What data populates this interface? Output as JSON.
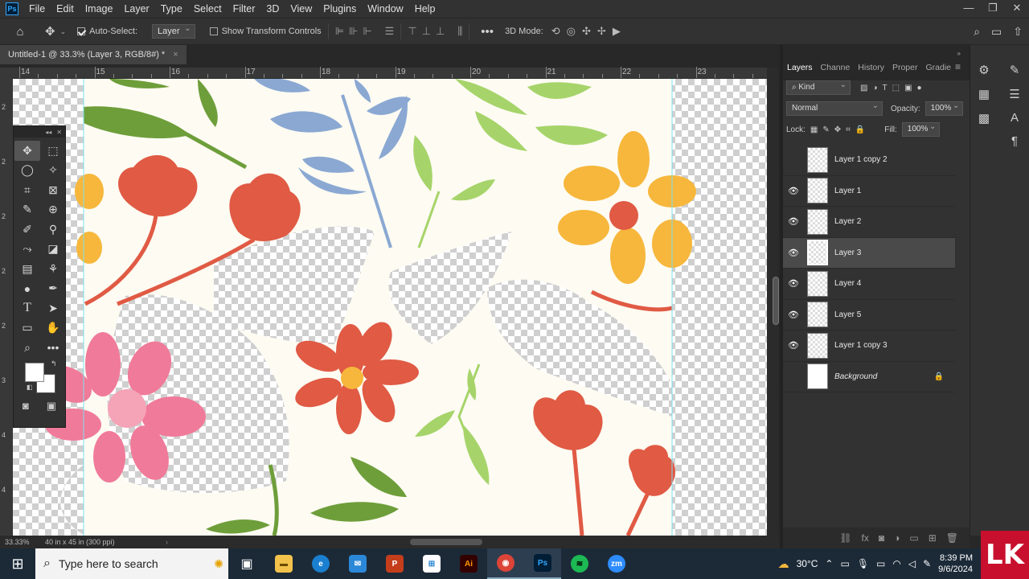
{
  "menu": {
    "app_logo": "Ps",
    "items": [
      "File",
      "Edit",
      "Image",
      "Layer",
      "Type",
      "Select",
      "Filter",
      "3D",
      "View",
      "Plugins",
      "Window",
      "Help"
    ],
    "window_controls": [
      "—",
      "❐",
      "✕"
    ]
  },
  "options": {
    "auto_select_label": "Auto-Select:",
    "auto_select_checked": true,
    "auto_select_target": "Layer",
    "show_transform_label": "Show Transform Controls",
    "show_transform_checked": false,
    "mode_3d_label": "3D Mode:"
  },
  "document": {
    "tab_title": "Untitled-1 @ 33.3% (Layer 3, RGB/8#) *",
    "close_glyph": "×"
  },
  "ruler": {
    "h_labels": [
      "14",
      "15",
      "16",
      "17",
      "18",
      "19",
      "20",
      "21",
      "22",
      "23"
    ],
    "v_labels": [
      "2",
      "2",
      "2",
      "2",
      "2",
      "3",
      "4",
      "4"
    ]
  },
  "status": {
    "zoom": "33.33%",
    "doc_size": "40 in x 45 in (300 ppi)",
    "arrow": "›"
  },
  "layers_panel": {
    "tabs": [
      "Layers",
      "Channe",
      "History",
      "Proper",
      "Gradie"
    ],
    "active_tab": "Layers",
    "filter_kind": "Kind",
    "blend_mode": "Normal",
    "opacity_label": "Opacity:",
    "opacity": "100%",
    "lock_label": "Lock:",
    "fill_label": "Fill:",
    "fill": "100%",
    "layers": [
      {
        "name": "Layer 1 copy 2",
        "visible": false,
        "selected": false,
        "italic": false,
        "locked": false
      },
      {
        "name": "Layer 1",
        "visible": true,
        "selected": false,
        "italic": false,
        "locked": false
      },
      {
        "name": "Layer 2",
        "visible": true,
        "selected": false,
        "italic": false,
        "locked": false
      },
      {
        "name": "Layer 3",
        "visible": true,
        "selected": true,
        "italic": false,
        "locked": false
      },
      {
        "name": "Layer 4",
        "visible": true,
        "selected": false,
        "italic": false,
        "locked": false
      },
      {
        "name": "Layer 5",
        "visible": true,
        "selected": false,
        "italic": false,
        "locked": false
      },
      {
        "name": "Layer 1 copy 3",
        "visible": true,
        "selected": false,
        "italic": false,
        "locked": false
      },
      {
        "name": "Background",
        "visible": false,
        "selected": false,
        "italic": true,
        "locked": true
      }
    ]
  },
  "taskbar": {
    "search_placeholder": "Type here to search",
    "temperature": "30°C",
    "time": "8:39 PM",
    "date": "9/6/2024",
    "apps": [
      "task-view",
      "file-explorer",
      "edge",
      "mail",
      "powerpoint",
      "store",
      "illustrator",
      "chrome",
      "photoshop",
      "spotify",
      "zoom"
    ],
    "app_labels": {
      "illustrator": "Ai",
      "photoshop": "Ps",
      "zoom": "zm",
      "powerpoint": "P"
    }
  },
  "brand_logo": "LK",
  "colors": {
    "canvas_bg": "#fdfbf2",
    "red_flower": "#e05a44",
    "yellow_flower": "#f6b73c",
    "pink_flower": "#f07a99",
    "blue_leaf": "#8aa8d2",
    "green_leaf": "#a6d46a",
    "dark_green": "#6e9e3a"
  }
}
